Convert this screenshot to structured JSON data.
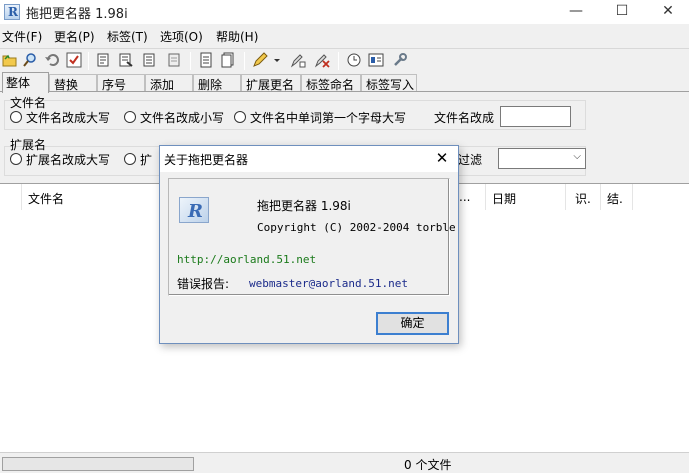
{
  "window": {
    "title": "拖把更名器 1.98i",
    "minimize_label": "—",
    "maximize_label": "☐",
    "close_label": "✕"
  },
  "menu": {
    "items": [
      "文件(F)",
      "更名(P)",
      "标签(T)",
      "选项(O)",
      "帮助(H)"
    ]
  },
  "tabs": [
    "整体",
    "替换",
    "序号",
    "添加",
    "删除",
    "扩展更名",
    "标签命名",
    "标签写入"
  ],
  "panel": {
    "filename_group": "文件名",
    "opt_upper": "文件名改成大写",
    "opt_lower": "文件名改成小写",
    "opt_capitalize": "文件名中单词第一个字母大写",
    "rename_to_label": "文件名改成",
    "rename_to_value": "",
    "ext_group": "扩展名",
    "ext_upper": "扩展名改成大写",
    "ext_partial": "扩",
    "filter_label": "过滤",
    "filter_value": ""
  },
  "list": {
    "col_filename": "文件名",
    "col_ellipsis": "...",
    "col_date": "日期",
    "col_id": "识.",
    "col_result": "结."
  },
  "status": {
    "file_count": "0 个文件"
  },
  "dialog": {
    "title": "关于拖把更名器",
    "close_label": "✕",
    "app_name": "拖把更名器 1.98i",
    "copyright": "Copyright (C) 2002-2004 torble",
    "url": "http://aorland.51.net",
    "report_label": "错误报告:",
    "email": "webmaster@aorland.51.net",
    "ok_label": "确定"
  },
  "colors": {
    "url_green": "#1a7a1a",
    "email_blue": "#1a2a8a",
    "dialog_border": "#6e8fbd",
    "ok_focus": "#3c7fd0"
  }
}
